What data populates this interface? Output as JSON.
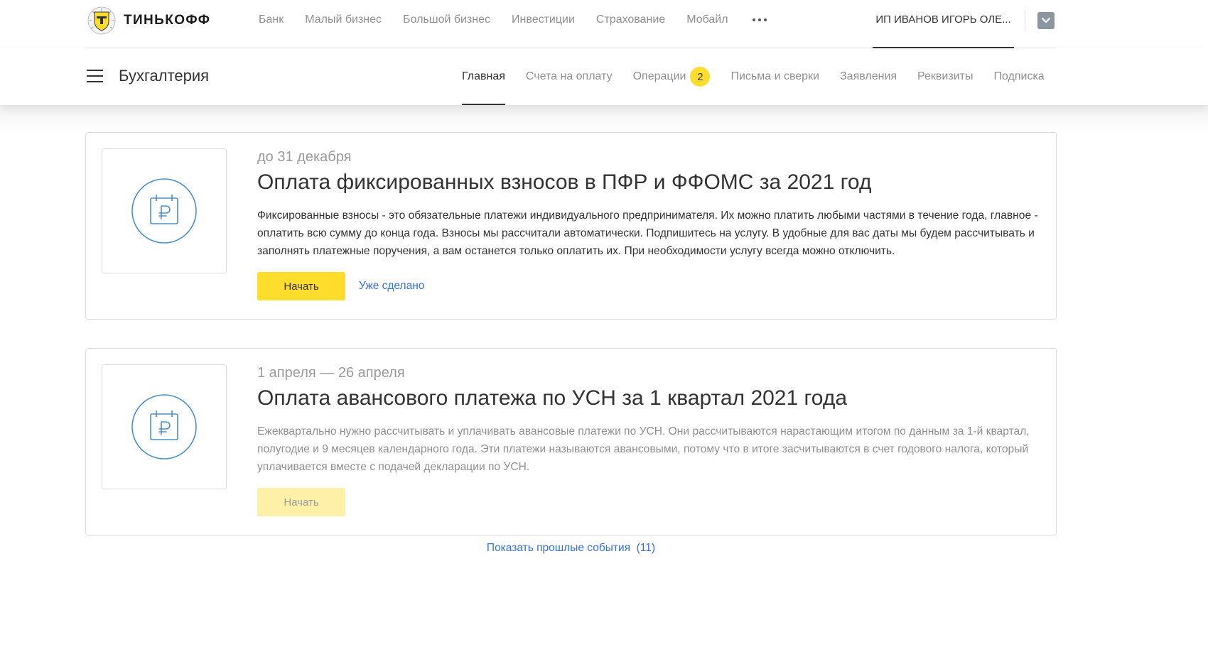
{
  "header": {
    "logo_text": "ТИНЬКОФФ",
    "nav": [
      "Банк",
      "Малый бизнес",
      "Большой бизнес",
      "Инвестиции",
      "Страхование",
      "Мобайл"
    ],
    "more_icon": "more-horizontal-icon",
    "account_name": "ИП ИВАНОВ ИГОРЬ ОЛЕ...",
    "account_toggle_icon": "chevron-down-icon"
  },
  "section": {
    "menu_icon": "hamburger-menu-icon",
    "title": "Бухгалтерия",
    "tabs": [
      {
        "label": "Главная",
        "active": true
      },
      {
        "label": "Счета на оплату"
      },
      {
        "label": "Операции",
        "badge": "2"
      },
      {
        "label": "Письма и сверки"
      },
      {
        "label": "Заявления"
      },
      {
        "label": "Реквизиты"
      },
      {
        "label": "Подписка"
      }
    ]
  },
  "events": [
    {
      "icon": "ruble-calendar-icon",
      "date": "до 31 декабря",
      "title": "Оплата фиксированных взносов в ПФР и ФФОМС за 2021 год",
      "description": "Фиксированные взносы - это обязательные платежи индивидуального предпринимателя. Их можно платить любыми частями в течение года, главное - оплатить всю сумму до конца года. Взносы мы рассчитали автоматически. Подпишитесь на услугу. В удобные для вас даты мы будем рассчитывать и заполнять платежные поручения, а вам останется только оплатить их. При необходимости услугу всегда можно отключить.",
      "primary_button": "Начать",
      "secondary_link": "Уже сделано"
    },
    {
      "icon": "ruble-calendar-icon",
      "date": "1 апреля — 26 апреля",
      "title": "Оплата авансового платежа по УСН за 1 квартал 2021 года",
      "description": "Ежеквартально нужно рассчитывать и уплачивать авансовые платежи по УСН. Они рассчитываются нарастающим итогом по данным за 1-й квартал, полугодие и 9 месяцев календарного года. Эти платежи называются авансовыми, потому что в итоге засчитываются в счет годового налога, который уплачивается вместе с подачей декларации по УСН.",
      "primary_button": "Начать",
      "primary_disabled": true
    }
  ],
  "past_events": {
    "label": "Показать прошлые события",
    "count": "(11)"
  },
  "colors": {
    "brand_yellow": "#ffdd2d",
    "link_blue": "#336fee",
    "icon_blue": "#4a90c8",
    "text_primary": "#333333",
    "text_muted": "#8f8f8f"
  }
}
